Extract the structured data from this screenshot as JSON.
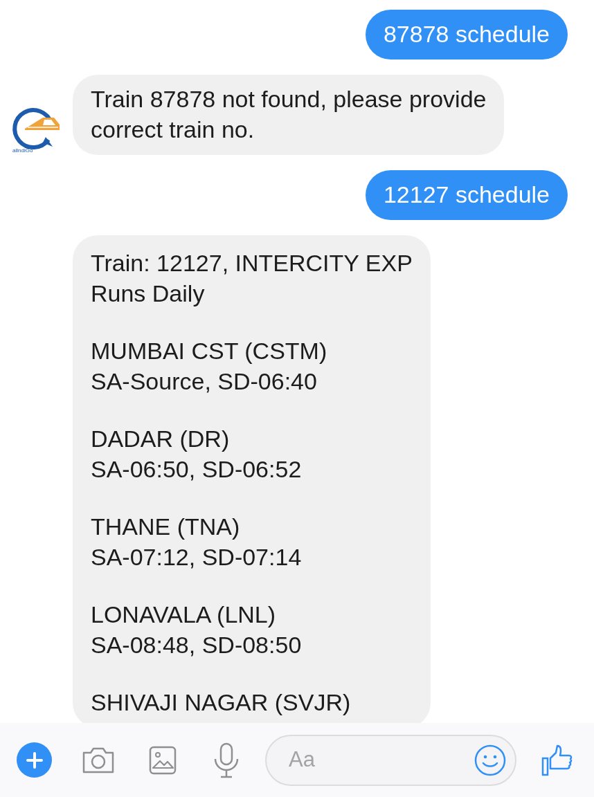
{
  "messages": [
    {
      "kind": "outgoing",
      "paragraphs": [
        [
          "87878 schedule"
        ]
      ]
    },
    {
      "kind": "incoming",
      "avatar": {
        "logo_text": "allndiGo"
      },
      "paragraphs": [
        [
          "Train 87878 not found, please provide",
          "correct train no."
        ]
      ]
    },
    {
      "kind": "outgoing",
      "paragraphs": [
        [
          "12127 schedule"
        ]
      ]
    },
    {
      "kind": "incoming",
      "paragraphs": [
        [
          "Train: 12127, INTERCITY EXP",
          "Runs Daily"
        ],
        [
          "MUMBAI CST (CSTM)",
          "SA-Source, SD-06:40"
        ],
        [
          "DADAR (DR)",
          "SA-06:50, SD-06:52"
        ],
        [
          "THANE (TNA)",
          "SA-07:12, SD-07:14"
        ],
        [
          "LONAVALA (LNL)",
          "SA-08:48, SD-08:50"
        ],
        [
          "SHIVAJI NAGAR (SVJR)"
        ]
      ]
    }
  ],
  "composer": {
    "placeholder": "Aa"
  }
}
